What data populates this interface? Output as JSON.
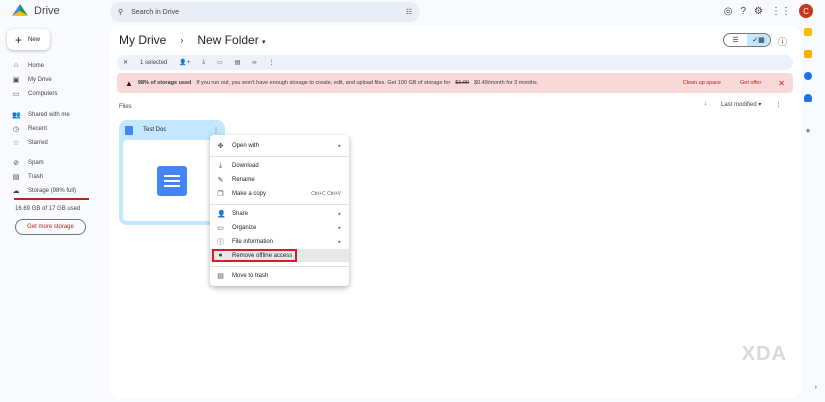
{
  "app": {
    "name": "Drive"
  },
  "search": {
    "placeholder": "Search in Drive"
  },
  "account": {
    "initial": "C"
  },
  "sidebar": {
    "new_label": "New",
    "items": [
      {
        "label": "Home",
        "icon": "home-icon"
      },
      {
        "label": "My Drive",
        "icon": "drive-icon"
      },
      {
        "label": "Computers",
        "icon": "computer-icon"
      },
      {
        "label": "Shared with me",
        "icon": "people-icon"
      },
      {
        "label": "Recent",
        "icon": "clock-icon"
      },
      {
        "label": "Starred",
        "icon": "star-icon"
      },
      {
        "label": "Spam",
        "icon": "spam-icon"
      },
      {
        "label": "Trash",
        "icon": "trash-icon"
      },
      {
        "label": "Storage (98% full)",
        "icon": "cloud-icon"
      }
    ],
    "storage_used": "16.69 GB of 17 GB used",
    "storage_fraction": 0.98,
    "get_more": "Get more storage"
  },
  "breadcrumb": {
    "root": "My Drive",
    "sep": "›",
    "current": "New Folder"
  },
  "selection": {
    "label": "1 selected"
  },
  "banner": {
    "bold": "98% of storage used",
    "text": "If you run out, you won't have enough storage to create, edit, and upload files. Get 100 GB of storage for",
    "old_price": "$1.99",
    "new_price": "$0.49/month for 3 months.",
    "clean": "Clean up space",
    "offer": "Get offer"
  },
  "files": {
    "heading": "Files",
    "sort": "Last modified"
  },
  "file": {
    "name": "Test Doc"
  },
  "menu": {
    "open_with": "Open with",
    "download": "Download",
    "rename": "Rename",
    "copy": "Make a copy",
    "copy_shortcut": "Ctrl+C Ctrl+V",
    "share": "Share",
    "organize": "Organize",
    "info": "File information",
    "offline": "Remove offline access",
    "trash": "Move to trash"
  },
  "watermark": "XDA"
}
